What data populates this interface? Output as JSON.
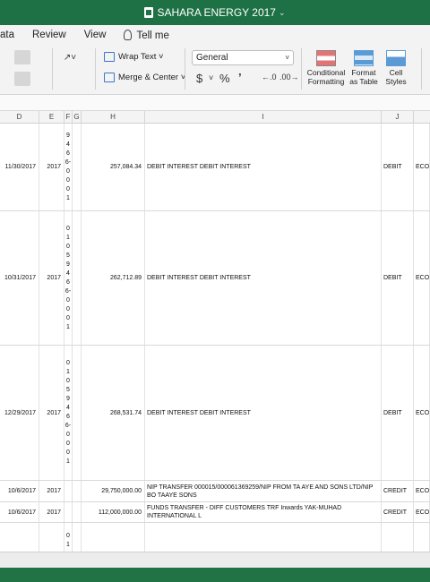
{
  "window": {
    "title": "SAHARA ENERGY 2017"
  },
  "menu": [
    "ata",
    "Review",
    "View"
  ],
  "tell_me": "Tell me",
  "ribbon": {
    "wrap_text": "Wrap Text",
    "merge_center": "Merge & Center",
    "number_format": "General",
    "currency": "$",
    "percent": "%",
    "comma": ")",
    "conditional_formatting": [
      "Conditional",
      "Formatting"
    ],
    "format_as_table": [
      "Format",
      "as Table"
    ],
    "cell_styles": [
      "Cell",
      "Styles"
    ]
  },
  "columns": [
    "D",
    "E",
    "F",
    "G",
    "H",
    "I",
    "J"
  ],
  "rows": [
    {
      "date": "11/30/2017",
      "year": "2017",
      "f_chars": [
        "9",
        "4",
        "6",
        "6-",
        "0",
        "0",
        "0",
        "1"
      ],
      "amount": "257,084.34",
      "desc": "DEBIT INTEREST DEBIT INTEREST",
      "type": "DEBIT",
      "k": "ECO"
    },
    {
      "date": "10/31/2017",
      "year": "2017",
      "f_chars": [
        "0",
        "1",
        "0",
        "5",
        "9",
        "4",
        "6",
        "6-",
        "0",
        "0",
        "0",
        "1"
      ],
      "amount": "262,712.89",
      "desc": "DEBIT INTEREST DEBIT INTEREST",
      "type": "DEBIT",
      "k": "ECO"
    },
    {
      "date": "12/29/2017",
      "year": "2017",
      "f_chars": [
        "0",
        "1",
        "0",
        "5",
        "9",
        "4",
        "6",
        "6-",
        "0",
        "0",
        "0",
        "1"
      ],
      "amount": "268,531.74",
      "desc": "DEBIT INTEREST DEBIT INTEREST",
      "type": "DEBIT",
      "k": "ECO"
    },
    {
      "date": "10/6/2017",
      "year": "2017",
      "f_chars": [],
      "amount": "29,750,000.00",
      "desc": "NIP TRANSFER 000015/000061369259/NIP FROM TA AYE AND SONS LTD/NIP BO TAAYE SONS",
      "type": "CREDIT",
      "k": "ECO"
    },
    {
      "date": "10/6/2017",
      "year": "2017",
      "f_chars": [],
      "amount": "112,000,000.00",
      "desc": "FUNDS TRANSFER - DIFF CUSTOMERS TRF Inwards YAK-MUHAD INTERNATIONAL L",
      "type": "CREDIT",
      "k": "ECO"
    },
    {
      "date": "",
      "year": "",
      "f_chars": [
        "0",
        "1"
      ],
      "amount": "",
      "desc": "",
      "type": "",
      "k": ""
    }
  ]
}
